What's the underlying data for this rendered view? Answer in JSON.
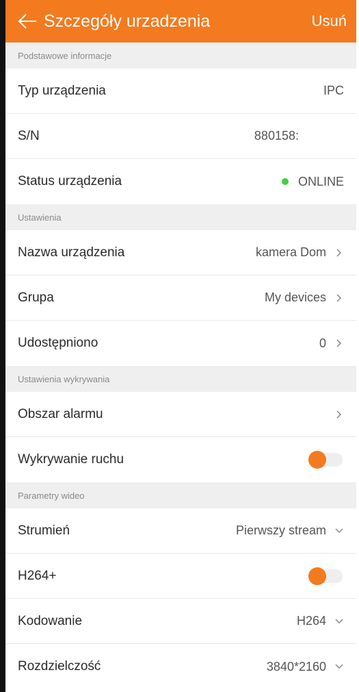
{
  "header": {
    "title": "Szczegóły urzadzenia",
    "delete_label": "Usuń",
    "back_icon": "arrow-left-icon"
  },
  "colors": {
    "accent": "#f47a1f",
    "online": "#3fd13f",
    "section_bg": "#efefef"
  },
  "sections": {
    "basic": {
      "title": "Podstawowe informacje",
      "device_type": {
        "label": "Typ urządzenia",
        "value": "IPC"
      },
      "serial": {
        "label": "S/N",
        "value": "880158:"
      },
      "status": {
        "label": "Status urządzenia",
        "value": "ONLINE"
      }
    },
    "settings": {
      "title": "Ustawienia",
      "device_name": {
        "label": "Nazwa urządzenia",
        "value": "kamera Dom"
      },
      "group": {
        "label": "Grupa",
        "value": "My devices"
      },
      "shared": {
        "label": "Udostępniono",
        "value": "0"
      }
    },
    "detection": {
      "title": "Ustawienia wykrywania",
      "alarm_area": {
        "label": "Obszar alarmu"
      },
      "motion": {
        "label": "Wykrywanie ruchu",
        "enabled": true
      }
    },
    "video": {
      "title": "Parametry wideo",
      "stream": {
        "label": "Strumień",
        "value": "Pierwszy stream"
      },
      "h264plus": {
        "label": "H264+",
        "enabled": true
      },
      "encoding": {
        "label": "Kodowanie",
        "value": "H264"
      },
      "resolution": {
        "label": "Rozdzielczość",
        "value": "3840*2160"
      }
    }
  }
}
